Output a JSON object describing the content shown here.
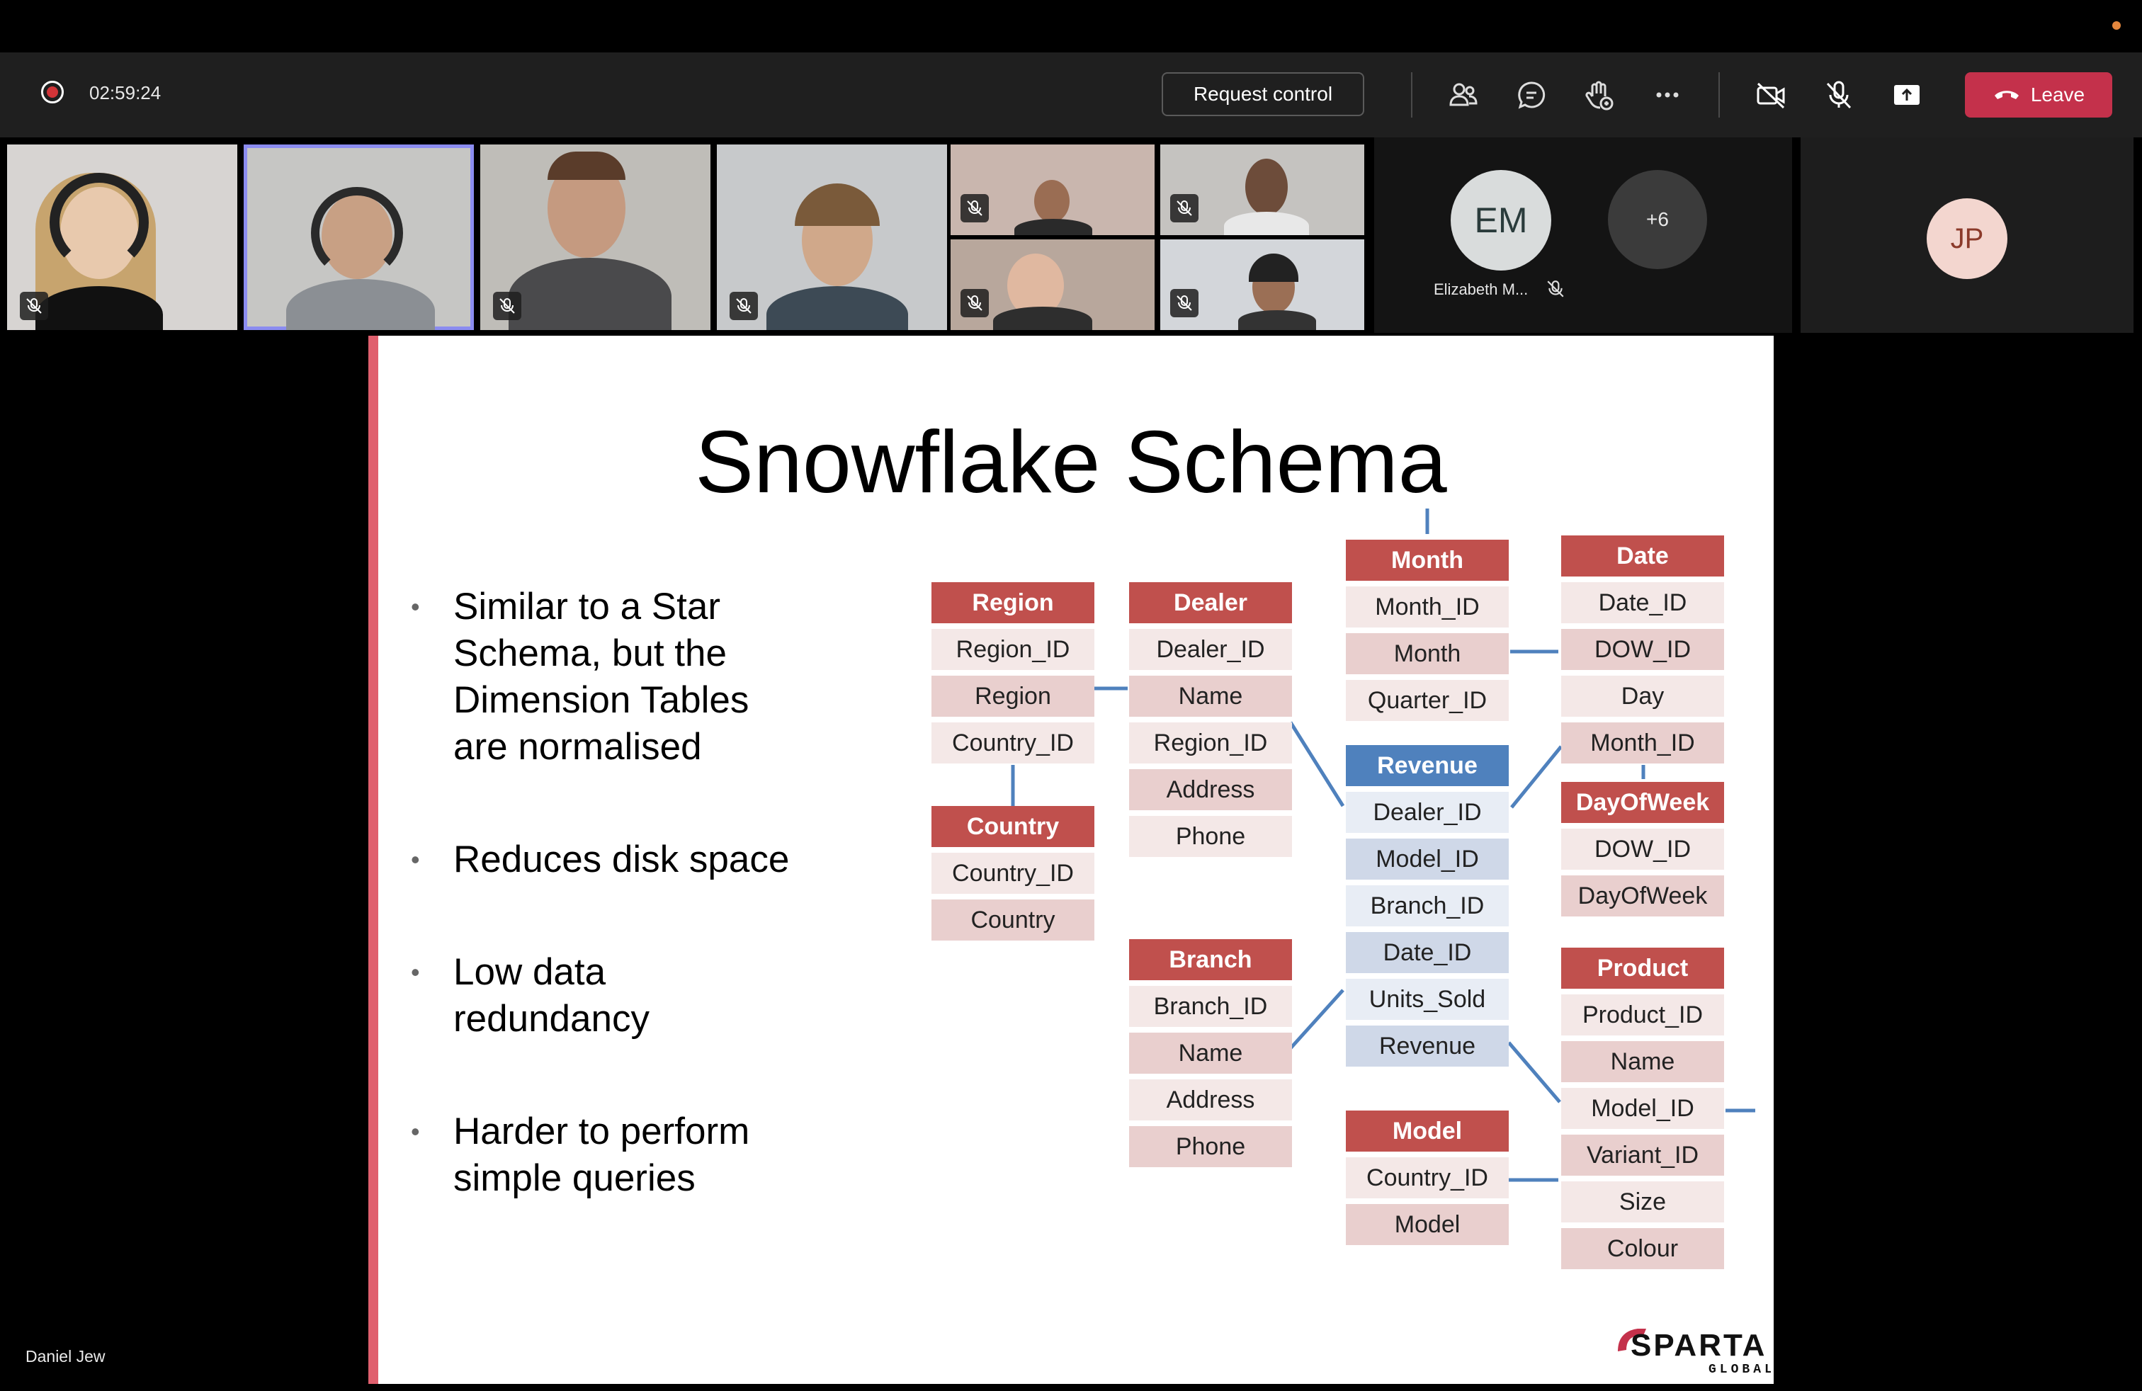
{
  "call": {
    "timer": "02:59:24",
    "request_control_label": "Request control",
    "leave_label": "Leave",
    "accent_color": "#c4314b"
  },
  "participants": {
    "overflow_label": "+6",
    "avatars": [
      {
        "initials": "EM",
        "name": "Elizabeth M...",
        "color": "#d9dcdc"
      },
      {
        "initials": "JP",
        "color": "#f3d6cf"
      }
    ],
    "presenter_name": "Daniel Jew"
  },
  "toolbar_icons": [
    "people-icon",
    "chat-icon",
    "raise-hand-icon",
    "more-icon",
    "camera-off-icon",
    "mic-off-icon",
    "share-tray-icon"
  ],
  "slide": {
    "title": "Snowflake Schema",
    "bullets": [
      "Similar to a Star\nSchema, but the\nDimension Tables\nare normalised",
      "Reduces disk space",
      "Low data\nredundancy",
      "Harder to perform\nsimple queries"
    ],
    "tables": {
      "region": {
        "header": "Region",
        "rows": [
          "Region_ID",
          "Region",
          "Country_ID"
        ]
      },
      "country": {
        "header": "Country",
        "rows": [
          "Country_ID",
          "Country"
        ]
      },
      "dealer": {
        "header": "Dealer",
        "rows": [
          "Dealer_ID",
          "Name",
          "Region_ID",
          "Address",
          "Phone"
        ]
      },
      "branch": {
        "header": "Branch",
        "rows": [
          "Branch_ID",
          "Name",
          "Address",
          "Phone"
        ]
      },
      "month": {
        "header": "Month",
        "rows": [
          "Month_ID",
          "Month",
          "Quarter_ID"
        ]
      },
      "revenue": {
        "header": "Revenue",
        "rows": [
          "Dealer_ID",
          "Model_ID",
          "Branch_ID",
          "Date_ID",
          "Units_Sold",
          "Revenue"
        ]
      },
      "model": {
        "header": "Model",
        "rows": [
          "Country_ID",
          "Model"
        ]
      },
      "date": {
        "header": "Date",
        "rows": [
          "Date_ID",
          "DOW_ID",
          "Day",
          "Month_ID"
        ]
      },
      "dayofweek": {
        "header": "DayOfWeek",
        "rows": [
          "DOW_ID",
          "DayOfWeek"
        ]
      },
      "product": {
        "header": "Product",
        "rows": [
          "Product_ID",
          "Name",
          "Model_ID",
          "Variant_ID",
          "Size",
          "Colour"
        ]
      }
    },
    "logo": {
      "text": "SPARTA",
      "subtext": "GLOBAL",
      "color": "#c4314b"
    }
  }
}
